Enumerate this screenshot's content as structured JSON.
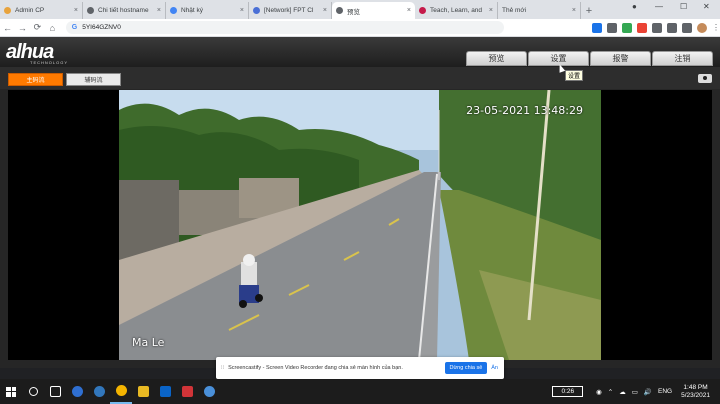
{
  "browser": {
    "tabs": [
      {
        "label": "Admin CP",
        "favicon_color": "#e8a33d",
        "active": false
      },
      {
        "label": "Chi tiết hostname",
        "favicon_color": "#5f6368",
        "active": false
      },
      {
        "label": "Nhật ký",
        "favicon_color": "#4285f4",
        "active": false
      },
      {
        "label": "[Network] FPT Cl",
        "favicon_color": "#4a6fd6",
        "active": false
      },
      {
        "label": "预览",
        "favicon_color": "#5f6368",
        "active": true
      },
      {
        "label": "Teach, Learn, and",
        "favicon_color": "#c51a4a",
        "active": false
      },
      {
        "label": "Thẻ mới",
        "favicon_color": "#dee1e6",
        "active": false
      }
    ],
    "close_glyph": "×",
    "new_tab_glyph": "+",
    "address": "5YI64GZNV0",
    "google_glyph": "G",
    "back_glyph": "←",
    "forward_glyph": "→",
    "reload_glyph": "⟳",
    "home_glyph": "⌂",
    "min_glyph": "—",
    "max_glyph": "☐",
    "winclose_glyph": "✕",
    "extensions": [
      "#1a73e8",
      "#5f6368",
      "#34a853",
      "#ea4335",
      "#5f6368",
      "#5f6368",
      "#5f6368",
      "#c58b5a"
    ]
  },
  "app": {
    "logo": "alhua",
    "logo_sub": "TECHNOLOGY",
    "menu": [
      "预览",
      "设置",
      "报警",
      "注销"
    ],
    "tooltip": "设置",
    "main_stream": "主码流",
    "sub_stream": "辅码流",
    "osd_time": "23-05-2021 13:48:29",
    "osd_name": "Ma Le"
  },
  "banner": {
    "grip": "⁞⁞",
    "text": "Screencastify - Screen Video Recorder đang chia sẻ màn hình của bạn.",
    "share_label": "Dừng chia sẻ",
    "hide_label": "Ẩn"
  },
  "taskbar": {
    "icons": [
      "#3c3c3c",
      "#3277bc",
      "#2f6fd1",
      "#f4b400",
      "#e8b923",
      "#0f7b0f",
      "#0a64c8",
      "#ffb900",
      "#d13438",
      "#4a90d9"
    ],
    "timer": "0:26",
    "language": "ENG",
    "time": "1:48 PM",
    "date": "5/23/2021",
    "tray_glyphs": [
      "◉",
      "⌃",
      "☁",
      "▭",
      "🔊"
    ]
  }
}
